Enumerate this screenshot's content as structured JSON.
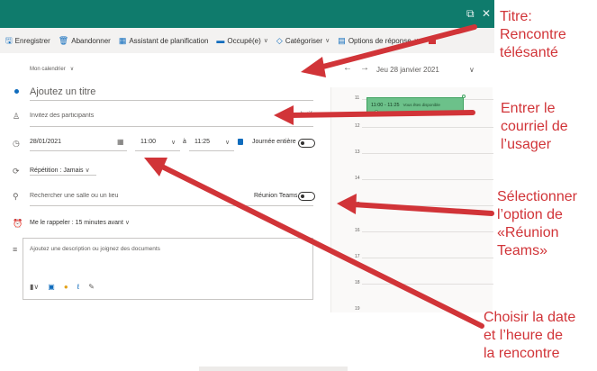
{
  "window": {
    "popout_icon": "popout-icon",
    "close_icon": "close-icon",
    "title_bar_color": "#0f7b6c"
  },
  "toolbar": {
    "save": "Enregistrer",
    "discard": "Abandonner",
    "scheduling": "Assistant de planification",
    "busy": "Occupé(e)",
    "categorize": "Catégoriser",
    "response_options": "Options de réponse"
  },
  "form": {
    "calendar_picker": "Mon calendrier",
    "title_placeholder": "Ajoutez un titre",
    "attendees_placeholder": "Invitez des participants",
    "attendees_optional": "Facultatif",
    "date": "28/01/2021",
    "start_time": "11:00",
    "time_separator": "à",
    "end_time": "11:25",
    "all_day": "Journée entière",
    "repeat": "Répétition : Jamais",
    "location_placeholder": "Rechercher une salle ou un lieu",
    "teams_meeting": "Réunion Teams",
    "reminder": "Me le rappeler : 15 minutes avant",
    "description_placeholder": "Ajoutez une description ou joignez des documents"
  },
  "calendar": {
    "date_label": "Jeu 28 janvier 2021",
    "hours": [
      "11",
      "12",
      "13",
      "14",
      "15",
      "16",
      "17",
      "18",
      "19"
    ],
    "event_time": "11:00 - 11:25",
    "event_status": "Vous êtes disponible",
    "event_color": "#6cc18a"
  },
  "annotations": {
    "title": [
      "Titre:",
      "Rencontre",
      "télésanté"
    ],
    "email": [
      "Entrer le",
      "courriel de",
      "l’usager"
    ],
    "teams": [
      "Sélectionner",
      "l’option de",
      "«Réunion",
      "Teams»"
    ],
    "date": [
      "Choisir la date",
      "et l’heure de",
      "la rencontre"
    ],
    "color": "#d13438"
  }
}
